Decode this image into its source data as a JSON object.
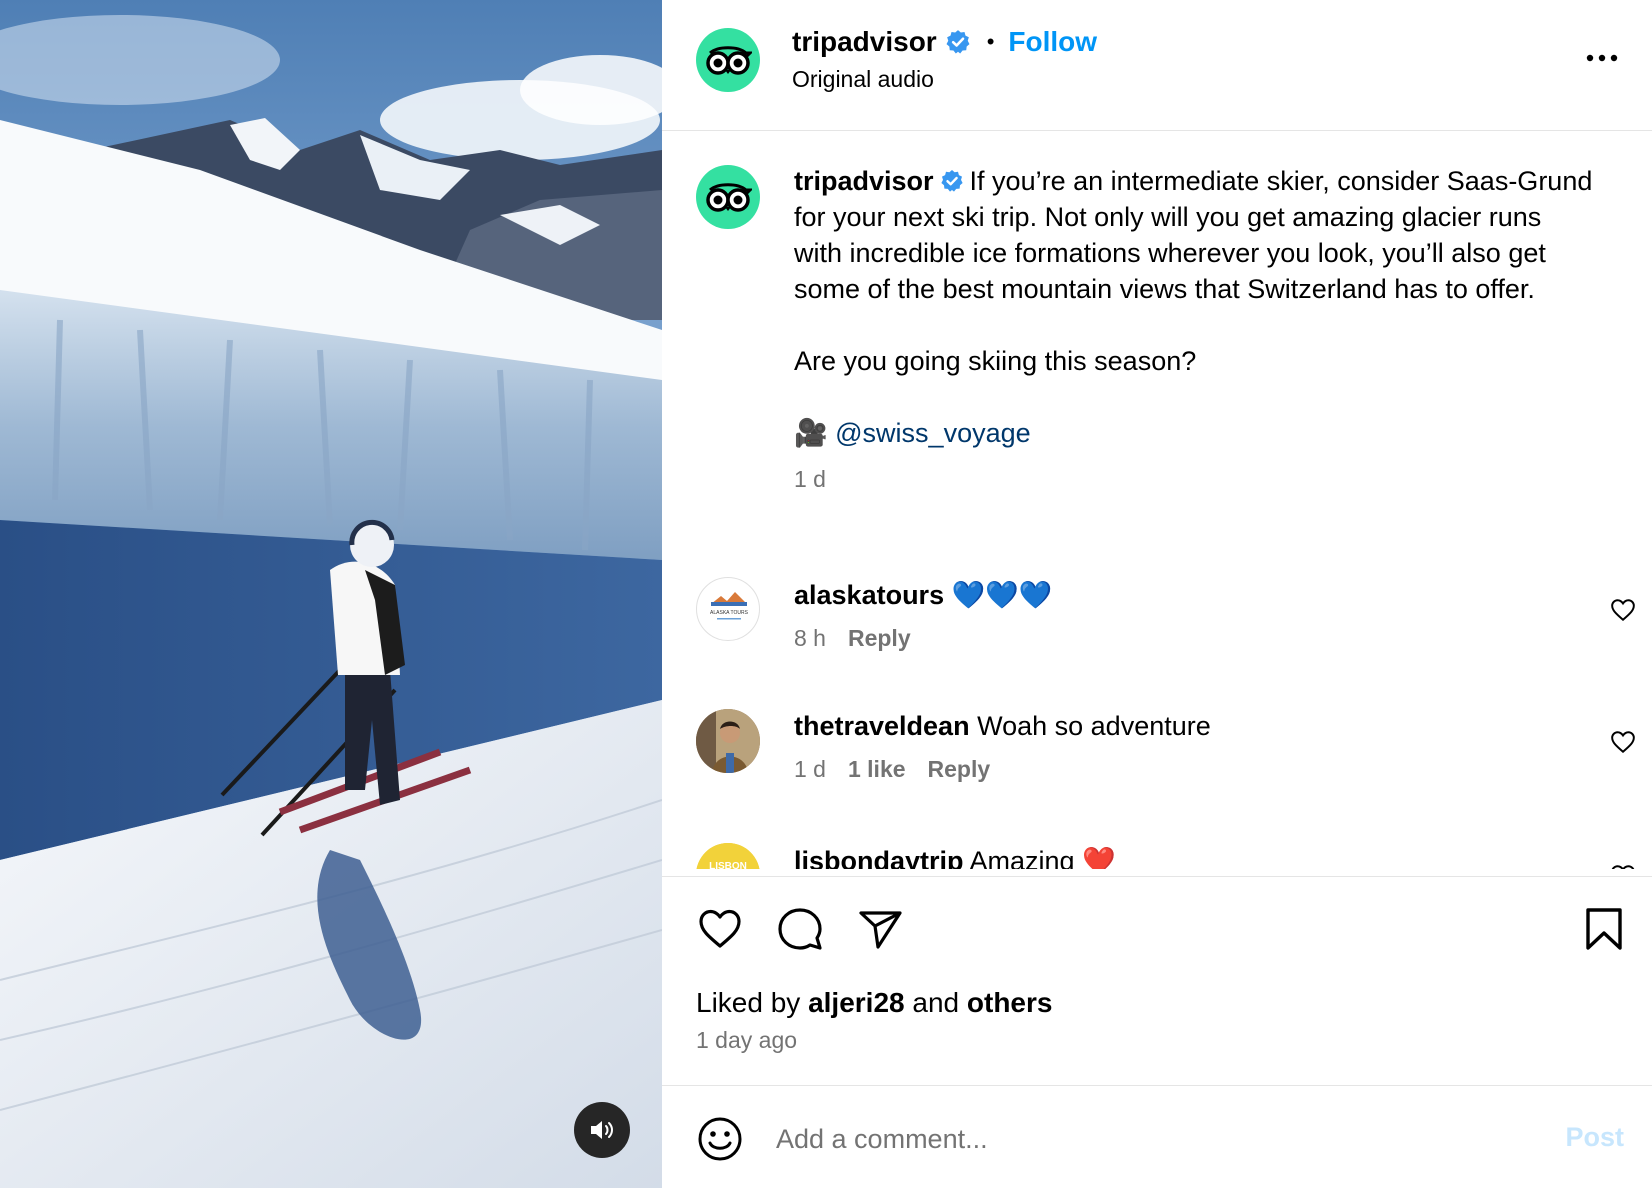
{
  "header": {
    "username": "tripadvisor",
    "separator": "•",
    "follow_label": "Follow",
    "subtitle": "Original audio"
  },
  "caption": {
    "username": "tripadvisor",
    "text": "If you’re an intermediate skier, consider Saas-Grund for your next ski trip. Not only will you get amazing glacier runs with incredible ice formations wherever you look, you’ll also get some of the best mountain views that Switzerland has to offer.\n\nAre you going skiing this season?",
    "credit_emoji": "🎥",
    "credit_handle": "@swiss_voyage",
    "time": "1 d"
  },
  "comments": [
    {
      "username": "alaskatours",
      "text": "💙💙💙",
      "time": "8 h",
      "likes": "",
      "reply_label": "Reply",
      "avatar_text": "ALASKA TOURS"
    },
    {
      "username": "thetraveldean",
      "text": "Woah so adventure",
      "time": "1 d",
      "likes": "1 like",
      "reply_label": "Reply"
    },
    {
      "username": "lisbondaytrip",
      "text": "Amazing ❤️",
      "avatar_text": "LISBON"
    }
  ],
  "likes": {
    "prefix": "Liked by",
    "user": "aljeri28",
    "middle": "and",
    "suffix": "others"
  },
  "posted_ago": "1 day ago",
  "add_comment": {
    "placeholder": "Add a comment...",
    "post_label": "Post"
  },
  "icons": {
    "brand": "tripadvisor-owl-icon",
    "verified_color": "#3897f0",
    "follow_color": "#0095f6",
    "avatar_color": "#34e0a1"
  }
}
